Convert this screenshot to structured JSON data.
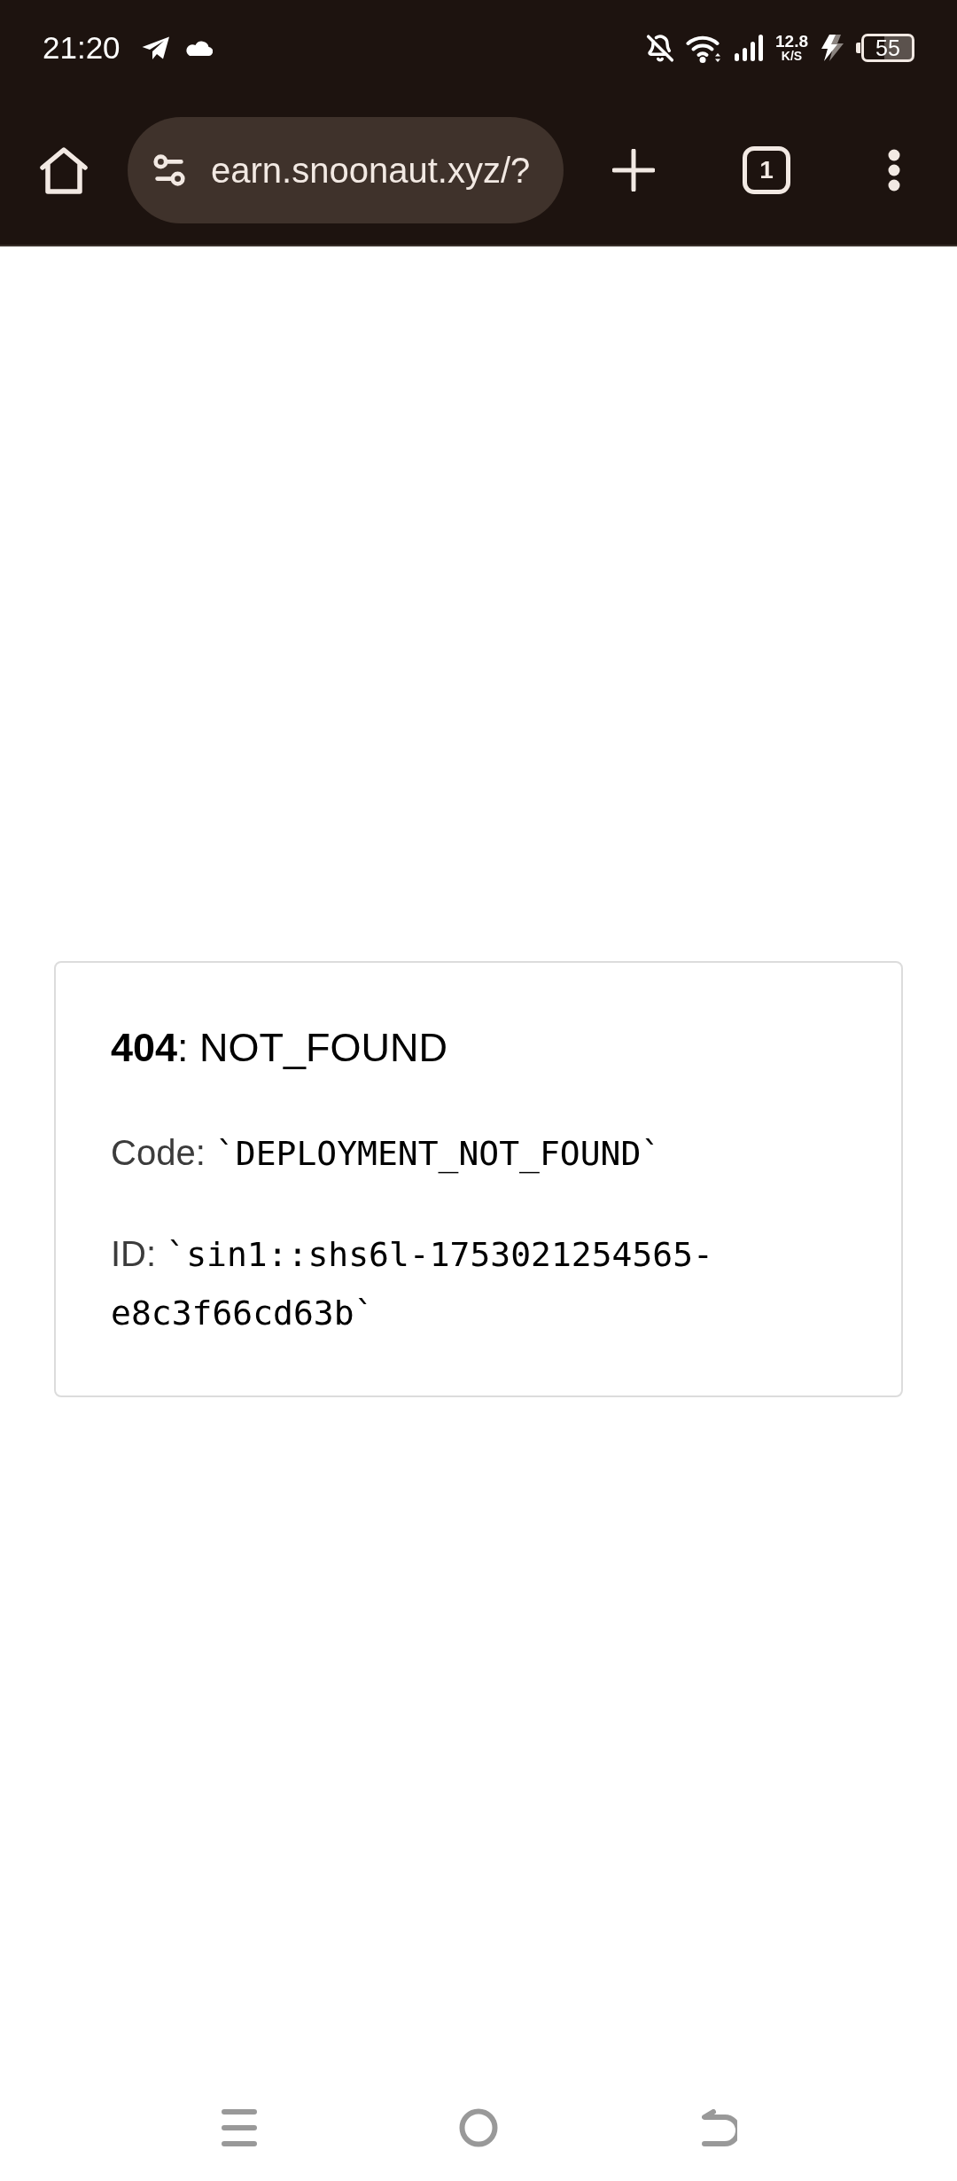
{
  "status_bar": {
    "time": "21:20",
    "network_speed": {
      "value": "12.8",
      "unit": "K/S"
    },
    "battery": "55"
  },
  "browser_toolbar": {
    "url": "earn.snoonaut.xyz/?",
    "tab_count": "1"
  },
  "error_card": {
    "title": "**404**: NOT_FOUND",
    "lines": [
      {
        "label": "Code:",
        "value": "`DEPLOYMENT_NOT_FOUND`"
      },
      {
        "label": "ID:",
        "value": "`sin1::shs6l-1753021254565-e8c3f66cd63b`"
      }
    ]
  }
}
